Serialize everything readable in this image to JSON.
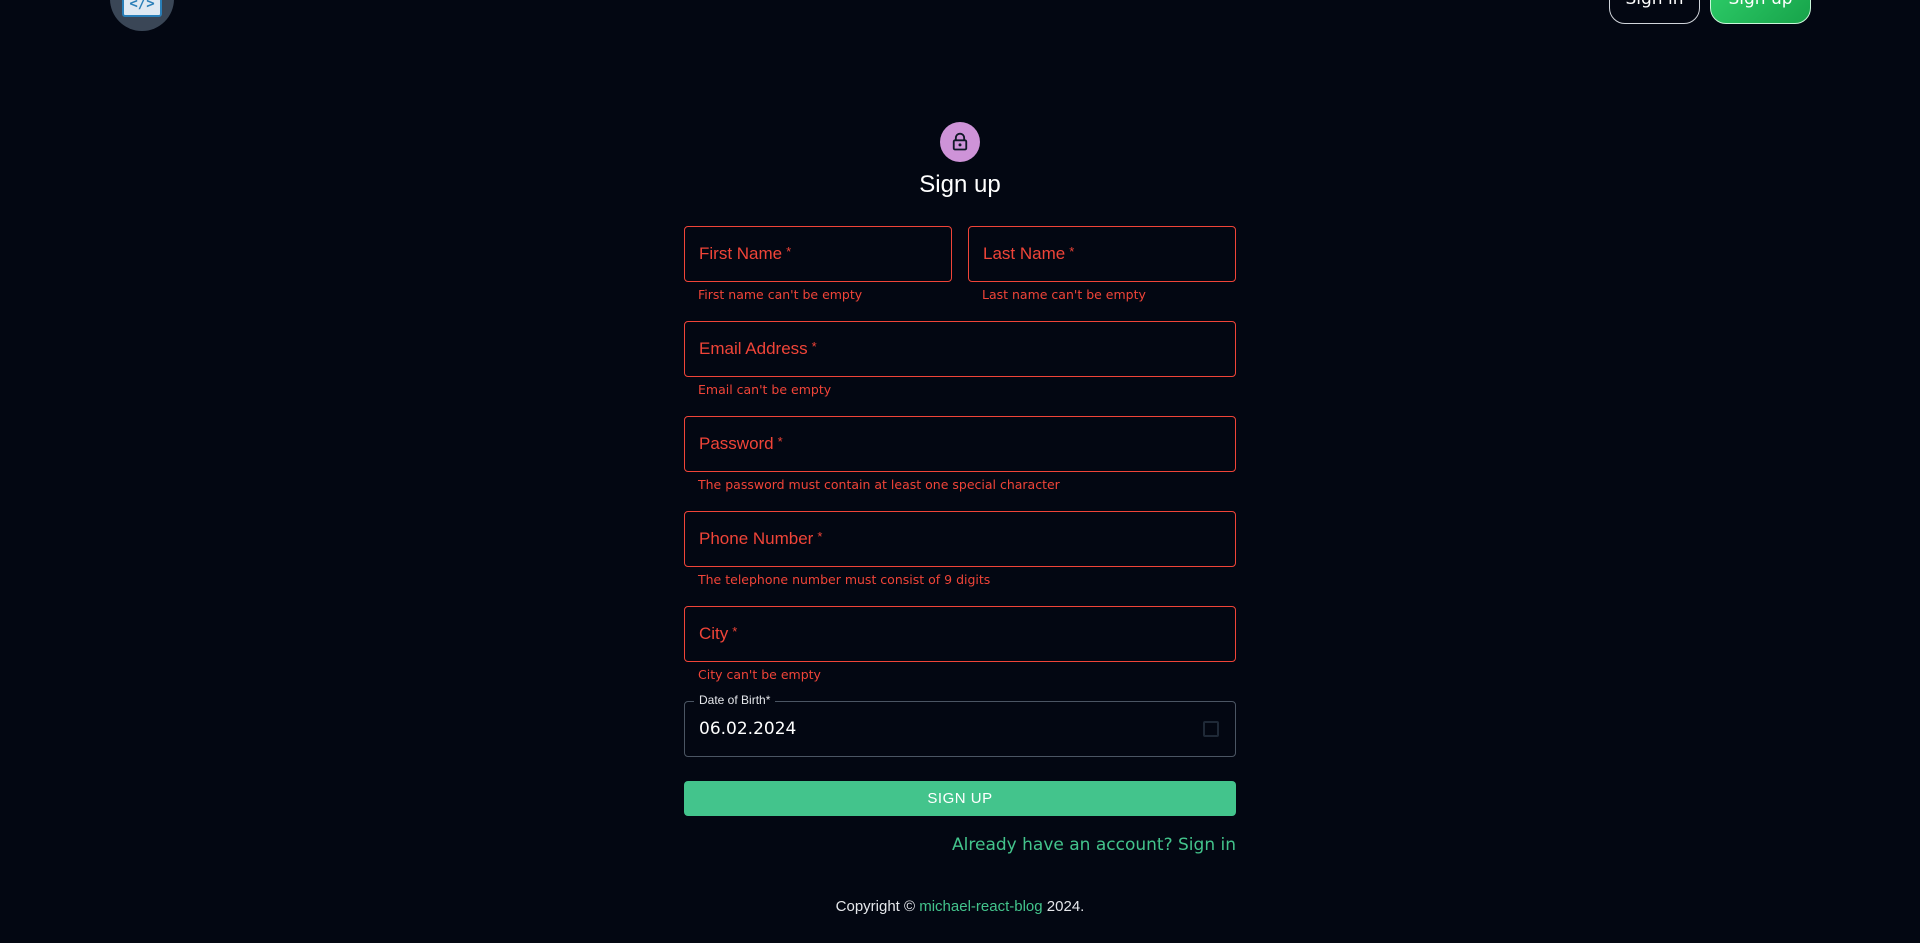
{
  "header": {
    "logo_icon": "code-book-icon",
    "logo_text": "</>",
    "signin_label": "Sign in",
    "signup_label": "Sign up"
  },
  "form": {
    "avatar_icon": "lock-icon",
    "title": "Sign up",
    "required_mark": "*",
    "first_name": {
      "label": "First Name",
      "error": "First name can't be empty"
    },
    "last_name": {
      "label": "Last Name",
      "error": "Last name can't be empty"
    },
    "email": {
      "label": "Email Address",
      "error": "Email can't be empty"
    },
    "password": {
      "label": "Password",
      "error": "The password must contain at least one special character"
    },
    "phone": {
      "label": "Phone Number",
      "error": "The telephone number must consist of 9 digits"
    },
    "city": {
      "label": "City",
      "error": "City can't be empty"
    },
    "dob": {
      "label": "Date of Birth",
      "value": "06.02.2024",
      "icon": "calendar-icon"
    },
    "submit_label": "SIGN UP",
    "signin_link": "Already have an account? Sign in"
  },
  "footer": {
    "prefix": "Copyright © ",
    "link": "michael-react-blog",
    "suffix": " 2024."
  },
  "colors": {
    "background": "#030712",
    "error": "#f04438",
    "accent": "#43c48c",
    "avatar": "#ce93d8"
  }
}
